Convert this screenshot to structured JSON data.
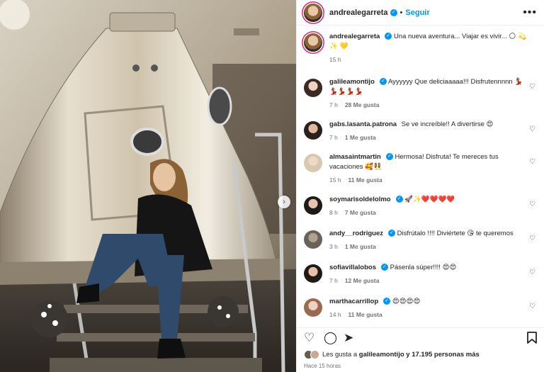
{
  "post": {
    "author": "andrealegarreta",
    "follow_label": "Seguir",
    "caption_text": "Una nueva aventura... Viajar es vivir...",
    "caption_emojis": "🌕 💫 ✨ 💛",
    "caption_time": "15 h"
  },
  "comments": [
    {
      "user": "galileamontijo",
      "verified": true,
      "text": "Ayyyyyy Que deliciaaaaa!!! Disfrutennnnn 💃🏽💃🏽💃🏽💃🏽💃🏽",
      "time": "7 h",
      "likes": "28 Me gusta"
    },
    {
      "user": "gabs.lasanta.patrona",
      "verified": false,
      "text": "Se ve increíble!! A divertirse 😍",
      "time": "7 h",
      "likes": "1 Me gusta"
    },
    {
      "user": "almasaintmartin",
      "verified": true,
      "text": "Hermosa! Disfruta! Te mereces tus vacaciones 🥰👯‍♀️",
      "time": "15 h",
      "likes": "11 Me gusta"
    },
    {
      "user": "soymarisoldelolmo",
      "verified": true,
      "text": "🚀✨❤️❤️❤️❤️",
      "time": "8 h",
      "likes": "7 Me gusta"
    },
    {
      "user": "andy__rodriguez",
      "verified": true,
      "text": "Disfrútalo !!!! Diviértete 😘 te queremos",
      "time": "3 h",
      "likes": "1 Me gusta"
    },
    {
      "user": "sofiavillalobos",
      "verified": true,
      "text": "Pásenla súper!!!! 😍😍",
      "time": "7 h",
      "likes": "12 Me gusta"
    },
    {
      "user": "marthacarrillop",
      "verified": true,
      "text": "😍😍😍😍",
      "time": "14 h",
      "likes": "11 Me gusta"
    }
  ],
  "footer": {
    "likes_prefix": "Les gusta a",
    "likes_user": "galileamontijo",
    "likes_suffix": "y 17.195 personas más",
    "time_ago": "Hace 15 horas"
  },
  "colors": {
    "accent": "#0095f6",
    "text": "#262626",
    "muted": "#737373"
  },
  "icons": [
    "more-icon",
    "heart-icon",
    "comment-icon",
    "share-icon",
    "bookmark-icon",
    "verified-icon",
    "next-arrow-icon"
  ]
}
